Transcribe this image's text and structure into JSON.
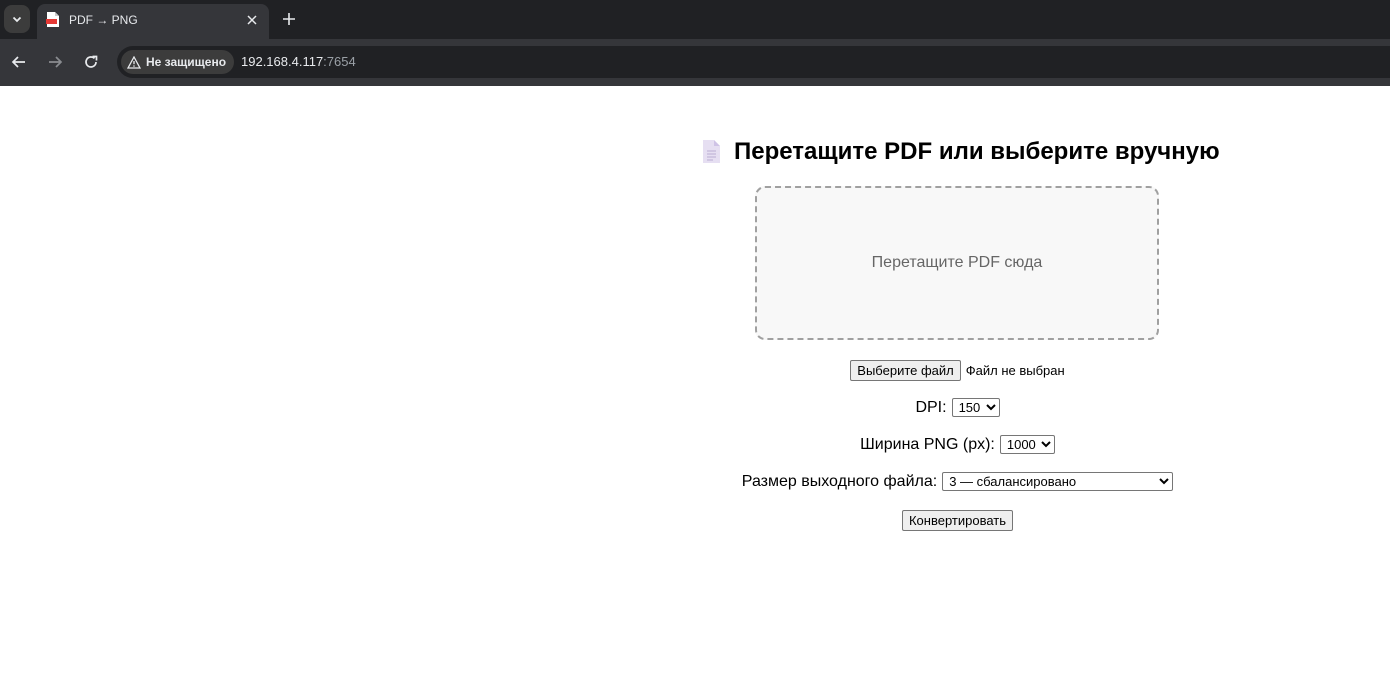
{
  "browser": {
    "tab_title": "PDF → PNG",
    "security_label": "Не защищено",
    "url_host": "192.168.4.117",
    "url_port": ":7654"
  },
  "page": {
    "heading": "Перетащите PDF или выберите вручную",
    "dropzone_text": "Перетащите PDF сюда",
    "choose_file_label": "Выберите файл",
    "file_status": "Файл не выбран",
    "dpi_label": "DPI:",
    "dpi_value": "150",
    "width_label": "Ширина PNG (px):",
    "width_value": "1000",
    "size_label": "Размер выходного файла:",
    "size_value": "3 — сбалансировано",
    "convert_label": "Конвертировать"
  },
  "icons": {
    "tab_favicon": "pdf-file-icon",
    "heading_icon": "document-icon"
  }
}
